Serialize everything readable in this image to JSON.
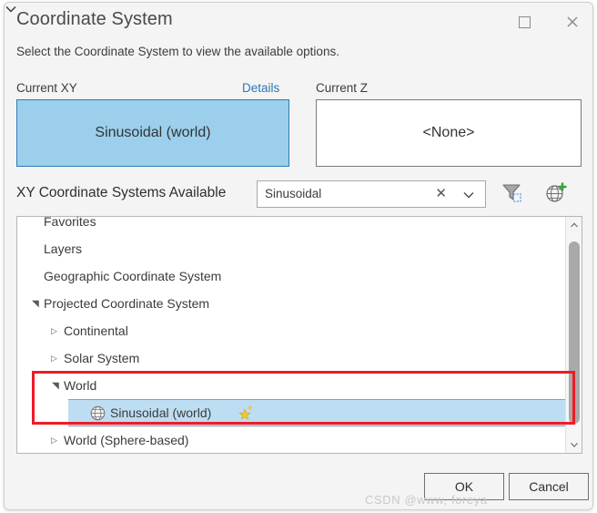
{
  "window": {
    "title": "Coordinate System",
    "maximize_icon": "maximize-icon",
    "close_icon": "close-icon"
  },
  "instruction": "Select the Coordinate System to view the available options.",
  "current_xy": {
    "label": "Current XY",
    "details_link": "Details",
    "value": "Sinusoidal (world)",
    "fill_color": "#9bcfec",
    "border_color": "#2d7cb8"
  },
  "current_z": {
    "label": "Current Z",
    "value": "<None>"
  },
  "available": {
    "label": "XY Coordinate Systems Available",
    "search_value": "Sinusoidal",
    "search_placeholder": "Search",
    "clear_icon": "✕",
    "dropdown_icon": "chevron-down-icon",
    "filter_icon": "filter-icon",
    "add_coordinate_system_icon": "globe-add-icon",
    "add_chevron_icon": "chevron-down-icon"
  },
  "tree": [
    {
      "label": "Favorites",
      "indent": 0,
      "twisty": "none",
      "selected": false,
      "icon": "none",
      "clipped": true
    },
    {
      "label": "Layers",
      "indent": 0,
      "twisty": "none",
      "selected": false,
      "icon": "none"
    },
    {
      "label": "Geographic Coordinate System",
      "indent": 0,
      "twisty": "none",
      "selected": false,
      "icon": "none"
    },
    {
      "label": "Projected Coordinate System",
      "indent": 0,
      "twisty": "expanded",
      "selected": false,
      "icon": "none"
    },
    {
      "label": "Continental",
      "indent": 1,
      "twisty": "collapsed",
      "selected": false,
      "icon": "none"
    },
    {
      "label": "Solar System",
      "indent": 1,
      "twisty": "collapsed",
      "selected": false,
      "icon": "none"
    },
    {
      "label": "World",
      "indent": 1,
      "twisty": "expanded",
      "selected": false,
      "icon": "none"
    },
    {
      "label": "Sinusoidal (world)",
      "indent": 2,
      "twisty": "none",
      "selected": true,
      "icon": "globe-icon",
      "badge": "favorite-star-icon"
    },
    {
      "label": "World (Sphere-based)",
      "indent": 1,
      "twisty": "collapsed",
      "selected": false,
      "icon": "none"
    }
  ],
  "scrollbar": {
    "up_icon": "chevron-up-icon",
    "down_icon": "chevron-down-icon"
  },
  "highlight": {
    "color": "#ee1c25"
  },
  "footer": {
    "ok_label": "OK",
    "cancel_label": "Cancel"
  },
  "watermark": "CSDN @www, foreya"
}
